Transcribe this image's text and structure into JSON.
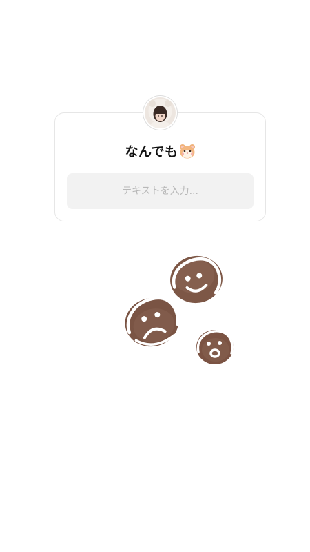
{
  "question_box": {
    "title": "なんでも",
    "title_emoji": "hamster-face-icon",
    "input_placeholder": "テキストを入力..."
  },
  "sticker": {
    "description_name": "gingerbread-cookies-sticker"
  },
  "colors": {
    "background": "#ffffff",
    "card_border": "#e6e6e6",
    "input_background": "#f2f2f2",
    "placeholder": "#b8b8b8",
    "title": "#111111",
    "cookie_brown": "#7a5544",
    "icing": "#ffffff"
  }
}
